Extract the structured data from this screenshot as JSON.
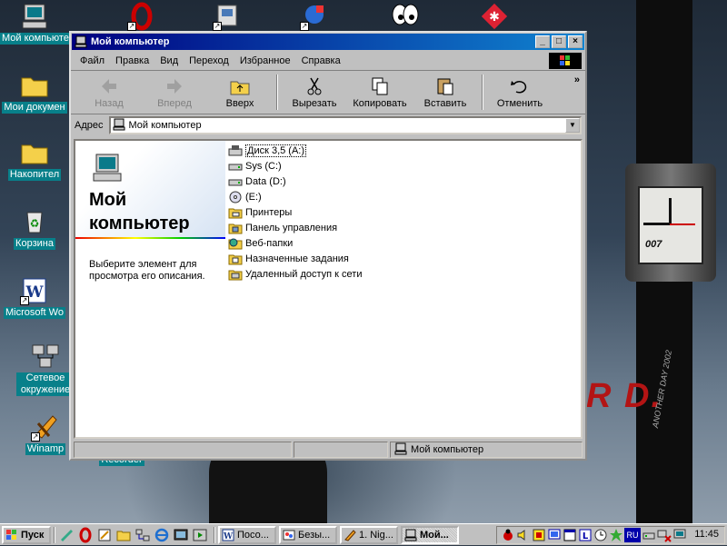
{
  "desktop": {
    "icons": [
      {
        "label": "Мой компьютер"
      },
      {
        "label": "Мои докумен"
      },
      {
        "label": "Накопител"
      },
      {
        "label": "Корзина"
      },
      {
        "label": "Microsoft Wo"
      },
      {
        "label": "Сетевое окружение"
      },
      {
        "label": "Winamp"
      },
      {
        "label": "Recorder"
      }
    ],
    "wallpaper": {
      "watch_brand": "007",
      "red_logo": "R D.",
      "strap_text": "ANOTHER DAY 2002"
    }
  },
  "window": {
    "title": "Мой компьютер",
    "menu": [
      "Файл",
      "Правка",
      "Вид",
      "Переход",
      "Избранное",
      "Справка"
    ],
    "toolbar": {
      "back": "Назад",
      "forward": "Вперед",
      "up": "Вверх",
      "cut": "Вырезать",
      "copy": "Копировать",
      "paste": "Вставить",
      "undo": "Отменить",
      "more": "»"
    },
    "address": {
      "label": "Адрес",
      "value": "Мой компьютер"
    },
    "left_pane": {
      "title": "Мой компьютер",
      "description": "Выберите элемент для просмотра его описания."
    },
    "items": [
      {
        "name": "Диск 3,5 (A:)",
        "icon": "floppy-drive-icon"
      },
      {
        "name": "Sys (C:)",
        "icon": "hard-drive-icon"
      },
      {
        "name": "Data (D:)",
        "icon": "hard-drive-icon"
      },
      {
        "name": " (E:)",
        "icon": "cd-drive-icon"
      },
      {
        "name": "Принтеры",
        "icon": "printers-folder-icon"
      },
      {
        "name": "Панель управления",
        "icon": "control-panel-icon"
      },
      {
        "name": "Веб-папки",
        "icon": "web-folders-icon"
      },
      {
        "name": "Назначенные задания",
        "icon": "scheduled-tasks-icon"
      },
      {
        "name": "Удаленный доступ к сети",
        "icon": "dial-up-networking-icon"
      }
    ],
    "status": {
      "location": "Мой компьютер"
    }
  },
  "taskbar": {
    "start": "Пуск",
    "tasks": [
      {
        "label": "Посо..."
      },
      {
        "label": "Безы..."
      },
      {
        "label": "1. Nig..."
      },
      {
        "label": "Мой..."
      }
    ],
    "tray": {
      "language": "RU",
      "clock": "11:45"
    }
  },
  "colors": {
    "titlebar_start": "#000080",
    "titlebar_end": "#1084d0",
    "face": "#c0c0c0",
    "desktop_label_bg": "#08808a"
  }
}
